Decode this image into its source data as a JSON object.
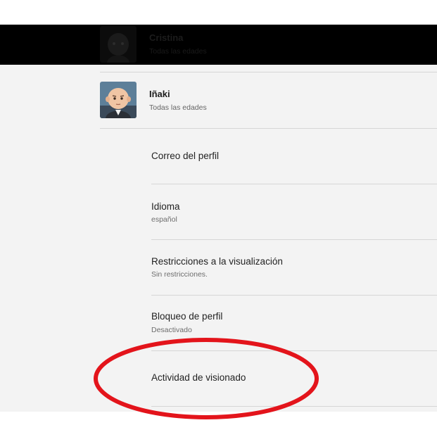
{
  "profiles": [
    {
      "name": "Cristina",
      "subtitle": "Todas las edades",
      "avatar_icon": "dark-profile-avatar-icon"
    },
    {
      "name": "Iñaki",
      "subtitle": "Todas las edades",
      "avatar_icon": "boss-baby-avatar-icon"
    }
  ],
  "settings": [
    {
      "title": "Correo del perfil",
      "value": ""
    },
    {
      "title": "Idioma",
      "value": "español"
    },
    {
      "title": "Restricciones a la visualización",
      "value": "Sin restricciones."
    },
    {
      "title": "Bloqueo de perfil",
      "value": "Desactivado"
    },
    {
      "title": "Actividad de visionado",
      "value": ""
    }
  ],
  "annotation": {
    "type": "red-ellipse-highlight",
    "target": "Actividad de visionado",
    "color": "#e3141b"
  },
  "colors": {
    "panel_background": "#f3f3f3",
    "top_band": "#000000",
    "divider": "#d6d6d6",
    "title_text": "#222222",
    "secondary_text": "#6d6d6d"
  }
}
